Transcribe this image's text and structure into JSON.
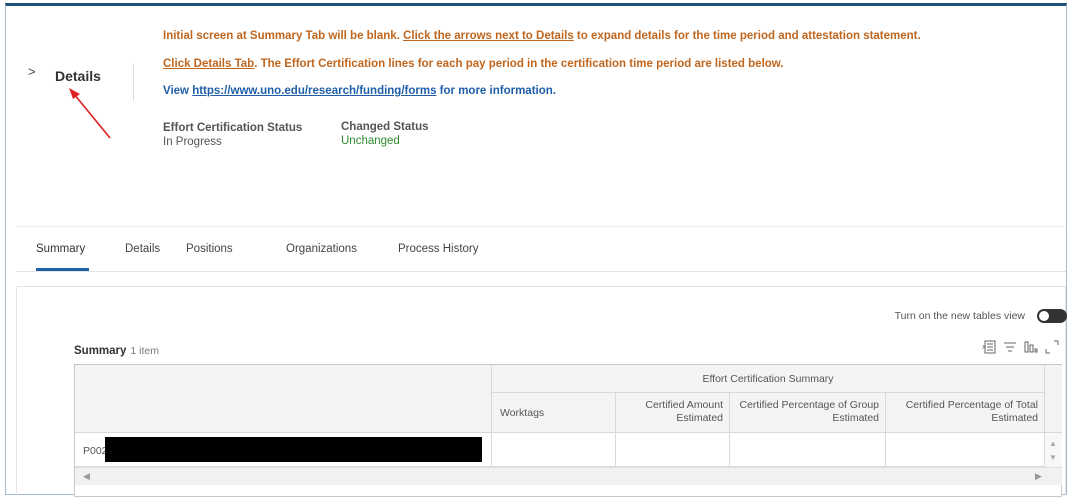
{
  "header": {
    "chevron": ">",
    "title": "Details",
    "instructions": {
      "line1_a": "Initial screen at Summary Tab will be blank. ",
      "line1_link": "Click the arrows next to Details",
      "line1_b": " to expand details for the time period and attestation statement.",
      "line2_link": "Click Details Tab",
      "line2_b": ". The Effort Certification lines for each pay period in the certification time period are listed below.",
      "line3_a": "View ",
      "line3_link": "https://www.uno.edu/research/funding/forms",
      "line3_b": " for more information."
    },
    "fields": {
      "effort_status_label": "Effort Certification Status",
      "effort_status_value": "In Progress",
      "changed_status_label": "Changed Status",
      "changed_status_value": "Unchanged"
    }
  },
  "tabs": [
    "Summary",
    "Details",
    "Positions",
    "Organizations",
    "Process History"
  ],
  "active_tab": "Summary",
  "toolbar": {
    "toggle_label": "Turn on the new tables view"
  },
  "summary": {
    "title": "Summary",
    "count": "1 item",
    "group_header": "Effort Certification Summary",
    "columns": [
      "Worktags",
      "Certified Amount Estimated",
      "Certified Percentage of Group Estimated",
      "Certified Percentage of Total Estimated"
    ],
    "rows": [
      {
        "id_prefix": "P002"
      }
    ]
  },
  "colors": {
    "accent": "#1f5fa8",
    "instruction": "#c0661e",
    "status_green": "#2e8b2e",
    "annotation_arrow": "#e02020"
  },
  "icons": [
    "chevron-right-icon",
    "excel-export-icon",
    "filter-icon",
    "chart-icon",
    "fullscreen-icon",
    "scroll-up-icon",
    "scroll-down-icon",
    "scroll-left-icon",
    "scroll-right-icon"
  ]
}
